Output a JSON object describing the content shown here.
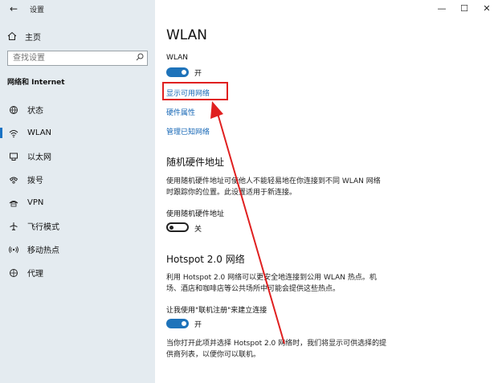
{
  "app": {
    "title": "设置",
    "back_icon": "back-arrow-icon"
  },
  "window": {
    "minimize": "—",
    "maximize": "☐",
    "close": "✕"
  },
  "sidebar": {
    "home_label": "主页",
    "search_placeholder": "查找设置",
    "section_heading": "网络和 Internet",
    "items": [
      {
        "label": "状态",
        "icon": "globe-icon"
      },
      {
        "label": "WLAN",
        "icon": "wifi-icon"
      },
      {
        "label": "以太网",
        "icon": "ethernet-icon"
      },
      {
        "label": "拨号",
        "icon": "dialup-icon"
      },
      {
        "label": "VPN",
        "icon": "vpn-icon"
      },
      {
        "label": "飞行模式",
        "icon": "airplane-icon"
      },
      {
        "label": "移动热点",
        "icon": "hotspot-icon"
      },
      {
        "label": "代理",
        "icon": "proxy-globe-icon"
      }
    ],
    "active_index": 1
  },
  "main": {
    "title": "WLAN",
    "wlan_label": "WLAN",
    "wlan_state": "开",
    "links": {
      "show_networks": "显示可用网络",
      "hardware_props": "硬件属性",
      "manage_known": "管理已知网络"
    },
    "random_hw": {
      "heading": "随机硬件地址",
      "desc": "使用随机硬件地址可使他人不能轻易地在你连接到不同 WLAN 网络时跟踪你的位置。此设置适用于新连接。",
      "toggle_label": "使用随机硬件地址",
      "state": "关"
    },
    "hotspot": {
      "heading": "Hotspot 2.0 网络",
      "desc": "利用 Hotspot 2.0 网络可以更安全地连接到公用 WLAN 热点。机场、酒店和咖啡店等公共场所中可能会提供这些热点。",
      "toggle_label": "让我使用\"联机注册\"来建立连接",
      "state": "开",
      "footer": "当你打开此项并选择 Hotspot 2.0 网络时，我们将显示可供选择的提供商列表，以便你可以联机。"
    }
  },
  "colors": {
    "accent": "#1e73ba",
    "link": "#1667b6",
    "annotation": "#e02020",
    "sidebar_bg": "#e4ebf0"
  }
}
